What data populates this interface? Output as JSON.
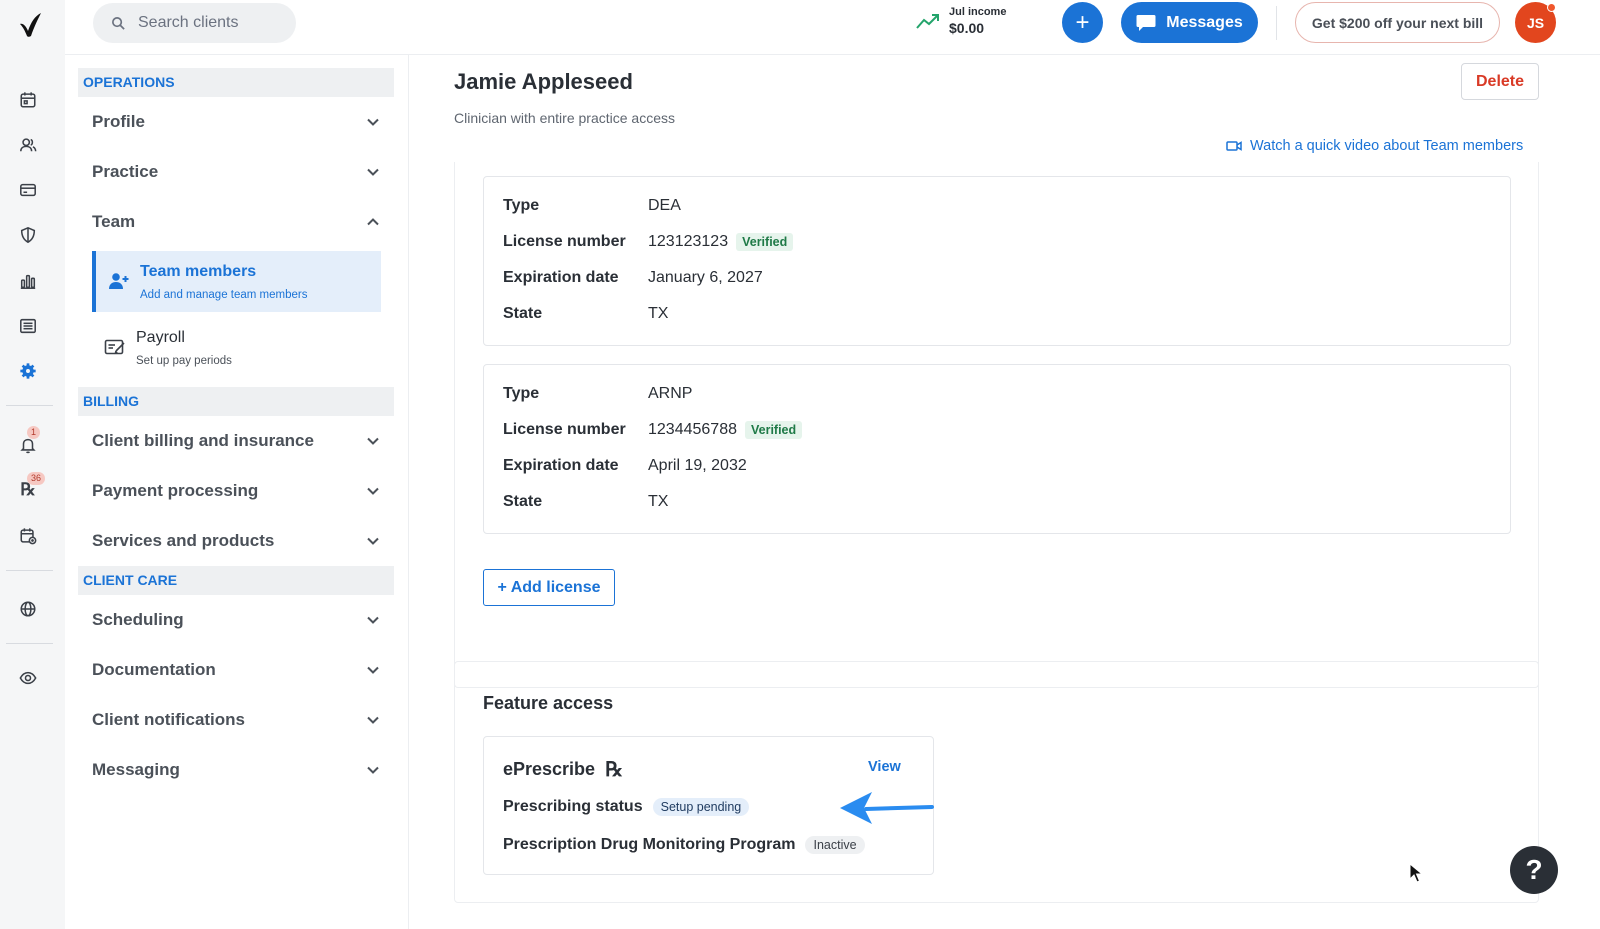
{
  "app": {
    "logo": "app-logo"
  },
  "topbar": {
    "search_placeholder": "Search clients",
    "income_label": "Jul income",
    "income_value": "$0.00",
    "plus_label": "+",
    "messages_label": "Messages",
    "promo_label": "Get $200 off your next bill",
    "avatar_initials": "JS"
  },
  "rail": {
    "notifications_badge": "1",
    "rx_badge": "36",
    "rx_glyph": "℞"
  },
  "sidenav": {
    "operations_header": "OPERATIONS",
    "profile": "Profile",
    "practice": "Practice",
    "team": "Team",
    "team_members": {
      "title": "Team members",
      "desc": "Add and manage team members"
    },
    "payroll": {
      "title": "Payroll",
      "desc": "Set up pay periods"
    },
    "billing_header": "BILLING",
    "client_billing": "Client billing and insurance",
    "payment_processing": "Payment processing",
    "services_products": "Services and products",
    "client_care_header": "CLIENT CARE",
    "scheduling": "Scheduling",
    "documentation": "Documentation",
    "client_notifications": "Client notifications",
    "messaging": "Messaging"
  },
  "main": {
    "title": "Jamie Appleseed",
    "subtitle": "Clinician with entire practice access",
    "delete_label": "Delete",
    "video_link": "Watch a quick video about Team members",
    "labels": {
      "type": "Type",
      "license_number": "License number",
      "expiration": "Expiration date",
      "state": "State",
      "verified": "Verified"
    },
    "licenses": [
      {
        "type": "DEA",
        "number": "123123123",
        "expiration": "January 6, 2027",
        "state": "TX"
      },
      {
        "type": "ARNP",
        "number": "1234456788",
        "expiration": "April 19, 2032",
        "state": "TX"
      }
    ],
    "add_license": "+ Add license",
    "feature_access": {
      "title": "Feature access",
      "eprescribe_title": "ePrescribe",
      "rx_glyph": "℞",
      "view_label": "View",
      "prescribing_status_label": "Prescribing status",
      "prescribing_status_value": "Setup pending",
      "pdmp_label": "Prescription Drug Monitoring Program",
      "pdmp_value": "Inactive"
    }
  },
  "help": {
    "label": "?"
  },
  "colors": {
    "accent": "#1b73d6",
    "danger": "#d93a26",
    "success": "#23a46b",
    "avatar": "#e2461e"
  }
}
